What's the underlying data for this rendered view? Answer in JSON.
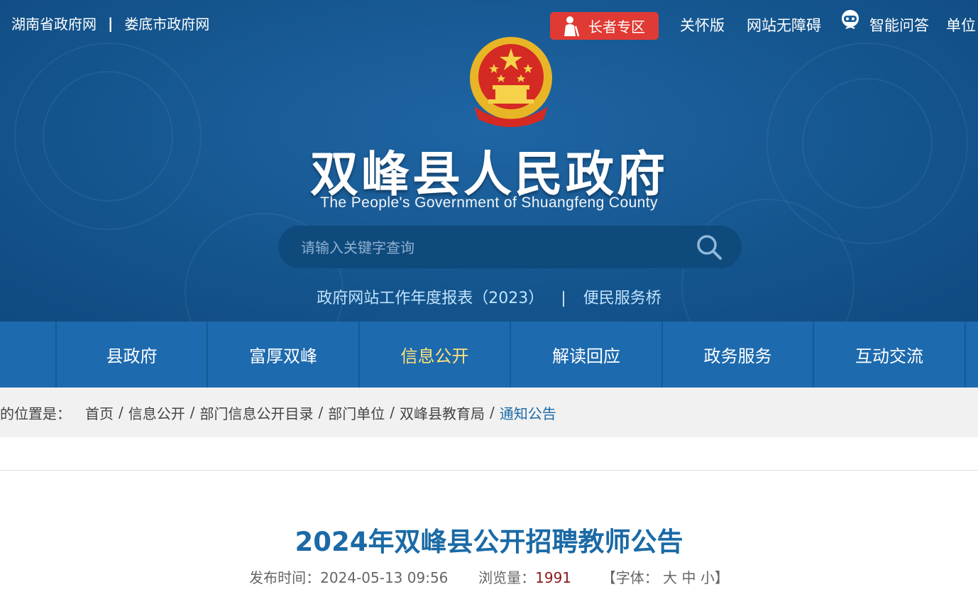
{
  "top_links": {
    "province": "湖南省政府网",
    "separator": "|",
    "city": "娄底市政府网"
  },
  "toolbar": {
    "elder_zone": "长者专区",
    "care_version": "关怀版",
    "accessibility": "网站无障碍",
    "smart_qa": "智能问答",
    "unit_login": "单位"
  },
  "site": {
    "title": "双峰县人民政府",
    "subtitle": "The People's Government of Shuangfeng County"
  },
  "search": {
    "placeholder": "请输入关键字查询"
  },
  "quick_links": {
    "report": "政府网站工作年度报表（2023）",
    "separator": "|",
    "service_bridge": "便民服务桥"
  },
  "nav": {
    "items": [
      {
        "label": "县政府"
      },
      {
        "label": "富厚双峰"
      },
      {
        "label": "信息公开"
      },
      {
        "label": "解读回应"
      },
      {
        "label": "政务服务"
      },
      {
        "label": "互动交流"
      }
    ],
    "active": "信息公开"
  },
  "breadcrumb": {
    "prefix": "在的位置是：",
    "items": [
      "首页",
      "信息公开",
      "部门信息公开目录",
      "部门单位",
      "双峰县教育局",
      "通知公告"
    ],
    "separator": "/"
  },
  "article": {
    "title": "2024年双峰县公开招聘教师公告",
    "publish_label": "发布时间：",
    "publish_time": "2024-05-13 09:56",
    "views_label": "浏览量：",
    "views": "1991",
    "font_open": "【字体：",
    "font_large": "大",
    "font_medium": "中",
    "font_small": "小",
    "font_close": "】"
  },
  "colors": {
    "header_bg": "#15568f",
    "nav_bg": "#1d6aae",
    "nav_active": "#ffe27a",
    "elder_button": "#e03a34",
    "title_blue": "#1b6aa6",
    "views_red": "#8b1a1a"
  }
}
